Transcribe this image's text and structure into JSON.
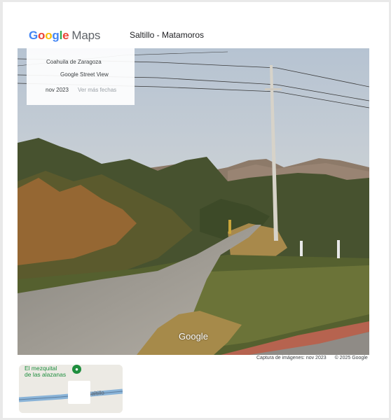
{
  "header": {
    "logo_text": "Google Maps",
    "title": "Saltillo - Matamoros"
  },
  "info_card": {
    "region": "Coahuila de Zaragoza",
    "source": "Google Street View",
    "date": "nov 2023",
    "more_dates": "Ver más fechas"
  },
  "streetview": {
    "watermark": "Google"
  },
  "credits": {
    "capture": "Captura de imágenes: nov 2023",
    "copyright": "© 2025 Google"
  },
  "minimap": {
    "poi_line1": "El mezquital",
    "poi_line2": "de las alazanas",
    "road_label": "ros - Saltillo"
  },
  "colors": {
    "accent_green": "#1e8e3e",
    "text_gray": "#5f6368"
  }
}
